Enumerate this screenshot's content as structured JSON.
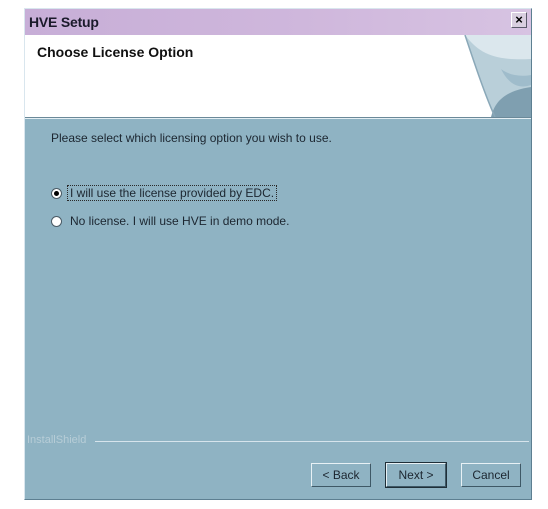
{
  "window": {
    "title": "HVE Setup",
    "close_symbol": "×"
  },
  "header": {
    "title": "Choose License Option"
  },
  "body": {
    "instructions": "Please select which licensing option you wish to use.",
    "options": [
      {
        "label": "I will use the license provided by EDC.",
        "selected": true
      },
      {
        "label": "No license.  I will use HVE in demo mode.",
        "selected": false
      }
    ]
  },
  "footer": {
    "brand": "InstallShield",
    "back_label": "< Back",
    "next_label": "Next >",
    "cancel_label": "Cancel"
  },
  "colors": {
    "dialog_background": "#8fb3c3",
    "title_bar": "#cfb7dc",
    "header_background": "#ffffff"
  },
  "icons": {
    "close": "close-icon",
    "header_graphic": "page-curl-graphic"
  }
}
